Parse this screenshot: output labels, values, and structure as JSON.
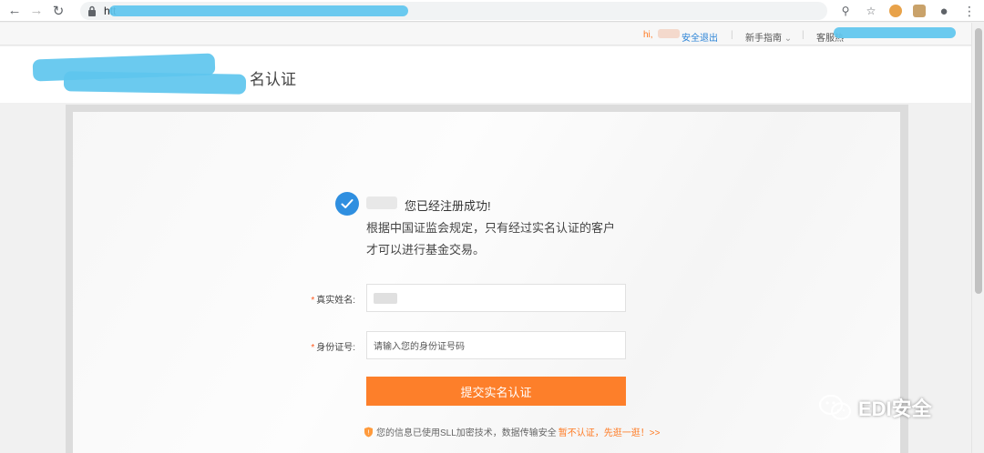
{
  "browser": {
    "url_prefix": "htt",
    "icons": [
      "back-icon",
      "forward-icon",
      "reload-icon",
      "lock-icon",
      "key-icon",
      "star-icon",
      "extension-icon",
      "extension-icon",
      "profile-icon",
      "menu-icon"
    ]
  },
  "topbar": {
    "greeting": "hi,",
    "logout": "安全退出",
    "sep": "|",
    "guide": "新手指南",
    "service": "客服热"
  },
  "header": {
    "title": "名认证"
  },
  "success": {
    "line1": "您已经注册成功!",
    "line2": "根据中国证监会规定，只有经过实名认证的客户",
    "line3": "才可以进行基金交易。"
  },
  "form": {
    "name_label": "真实姓名:",
    "id_label": "身份证号:",
    "required_mark": "*",
    "id_placeholder": "请输入您的身份证号码",
    "submit_label": "提交实名认证"
  },
  "security_note": {
    "text": "您的信息已使用SLL加密技术，数据传输安全",
    "skip": "暂不认证，先逛一逛！>>"
  },
  "watermark": {
    "text": "EDI安全"
  },
  "colors": {
    "accent": "#fd7f2a",
    "check": "#2f8fe0",
    "link": "#2b83d6"
  }
}
